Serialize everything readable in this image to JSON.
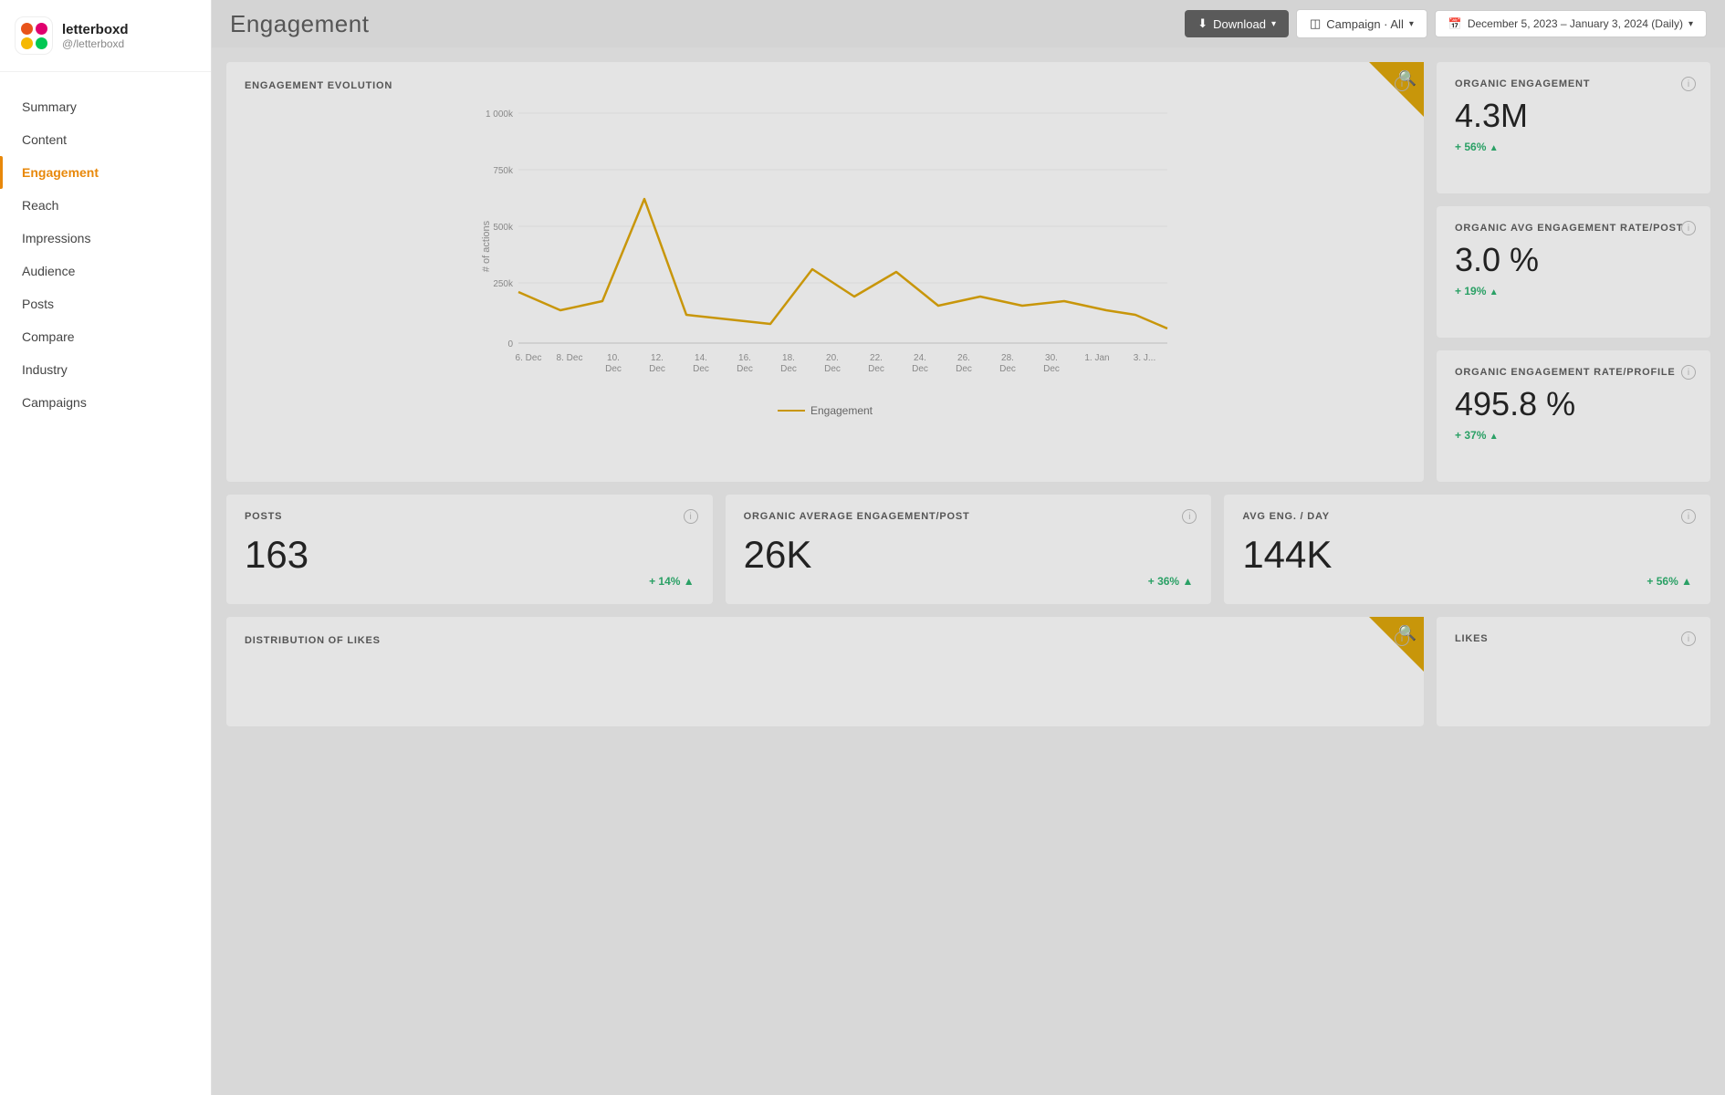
{
  "app": {
    "name": "letterboxd",
    "handle": "@/letterboxd"
  },
  "topbar": {
    "title": "Engagement",
    "download_label": "Download",
    "campaign_label": "Campaign · All",
    "date_range": "December 5, 2023 – January 3, 2024 (Daily)"
  },
  "sidebar": {
    "items": [
      {
        "label": "Summary",
        "active": false
      },
      {
        "label": "Content",
        "active": false
      },
      {
        "label": "Engagement",
        "active": true
      },
      {
        "label": "Reach",
        "active": false
      },
      {
        "label": "Impressions",
        "active": false
      },
      {
        "label": "Audience",
        "active": false
      },
      {
        "label": "Posts",
        "active": false
      },
      {
        "label": "Compare",
        "active": false
      },
      {
        "label": "Industry",
        "active": false
      },
      {
        "label": "Campaigns",
        "active": false
      }
    ]
  },
  "chart": {
    "title": "ENGAGEMENT EVOLUTION",
    "y_axis_label": "# of actions",
    "legend_label": "Engagement",
    "y_ticks": [
      "1 000k",
      "750k",
      "500k",
      "250k",
      "0"
    ],
    "x_ticks": [
      "6. Dec",
      "8. Dec",
      "10. Dec",
      "12. Dec",
      "14. Dec",
      "16. Dec",
      "18. Dec",
      "20. Dec",
      "22. Dec",
      "24. Dec",
      "26. Dec",
      "28. Dec",
      "30. Dec",
      "1. Jan",
      "3. J..."
    ]
  },
  "kpis": [
    {
      "title": "ORGANIC ENGAGEMENT",
      "value": "4.3M",
      "change": "+ 56%",
      "change_direction": "up"
    },
    {
      "title": "ORGANIC AVG ENGAGEMENT RATE/POST",
      "value": "3.0 %",
      "change": "+ 19%",
      "change_direction": "up"
    },
    {
      "title": "ORGANIC ENGAGEMENT RATE/PROFILE",
      "value": "495.8 %",
      "change": "+ 37%",
      "change_direction": "up"
    }
  ],
  "stats": [
    {
      "title": "POSTS",
      "value": "163",
      "change": "+ 14%",
      "change_direction": "up"
    },
    {
      "title": "ORGANIC AVERAGE ENGAGEMENT/POST",
      "value": "26K",
      "change": "+ 36%",
      "change_direction": "up"
    },
    {
      "title": "AVG ENG. / DAY",
      "value": "144K",
      "change": "+ 56%",
      "change_direction": "up"
    }
  ],
  "distribution": {
    "title": "DISTRIBUTION OF LIKES"
  },
  "likes_kpi": {
    "title": "LIKES"
  }
}
